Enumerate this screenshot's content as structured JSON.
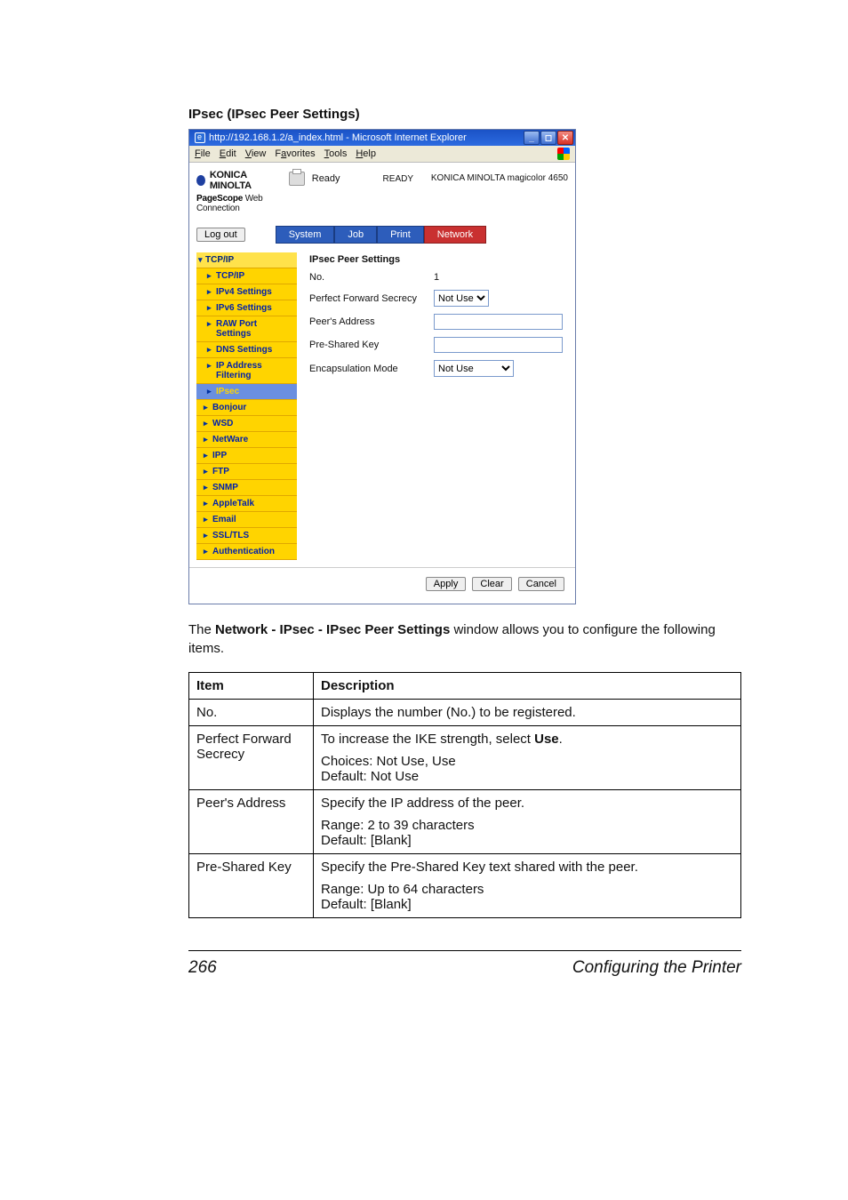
{
  "doc": {
    "heading": "IPsec (IPsec Peer Settings)",
    "copy_prefix": "The ",
    "copy_bold": "Network - IPsec - IPsec Peer Settings",
    "copy_suffix": " window allows you to configure the following items.",
    "page_number": "266",
    "footer_title": "Configuring the Printer"
  },
  "browser": {
    "title": "http://192.168.1.2/a_index.html - Microsoft Internet Explorer",
    "menus": {
      "file": "File",
      "edit": "Edit",
      "view": "View",
      "favorites": "Favorites",
      "tools": "Tools",
      "help": "Help"
    }
  },
  "header": {
    "brand": "KONICA MINOLTA",
    "pagescope_prefix": "PageScope",
    "pagescope_name": " Web Connection",
    "status_label": "Ready",
    "ready_badge": "READY",
    "device": "KONICA MINOLTA magicolor 4650"
  },
  "actions": {
    "logout": "Log out"
  },
  "tabs": {
    "system": "System",
    "job": "Job",
    "print": "Print",
    "network": "Network"
  },
  "nav": {
    "tcpip_group": "TCP/IP",
    "tcpip": "TCP/IP",
    "ipv4": "IPv4 Settings",
    "ipv6": "IPv6 Settings",
    "raw": "RAW Port Settings",
    "dns": "DNS Settings",
    "ipfilter": "IP Address Filtering",
    "ipsec": "IPsec",
    "bonjour": "Bonjour",
    "wsd": "WSD",
    "netware": "NetWare",
    "ipp": "IPP",
    "ftp": "FTP",
    "snmp": "SNMP",
    "appletalk": "AppleTalk",
    "email": "Email",
    "ssltls": "SSL/TLS",
    "auth": "Authentication"
  },
  "form": {
    "panel_title": "IPsec Peer Settings",
    "no_label": "No.",
    "no_value": "1",
    "pfs_label": "Perfect Forward Secrecy",
    "pfs_value": "Not Use",
    "peer_label": "Peer's Address",
    "peer_value": "",
    "psk_label": "Pre-Shared Key",
    "psk_value": "",
    "encap_label": "Encapsulation Mode",
    "encap_value": "Not Use"
  },
  "buttons": {
    "apply": "Apply",
    "clear": "Clear",
    "cancel": "Cancel"
  },
  "table": {
    "h_item": "Item",
    "h_desc": "Description",
    "rows": [
      {
        "item": "No.",
        "desc": "Displays the number (No.) to be registered.",
        "extra": ""
      },
      {
        "item": "Perfect Forward Secrecy",
        "desc": "To increase the IKE strength, select Use.",
        "extra": "Choices: Not Use, Use\nDefault:  Not Use",
        "bold_word": "Use"
      },
      {
        "item": "Peer's Address",
        "desc": "Specify the IP address of the peer.",
        "extra": "Range:   2 to 39 characters\nDefault:  [Blank]"
      },
      {
        "item": "Pre-Shared Key",
        "desc": "Specify the Pre-Shared Key text shared with the peer.",
        "extra": "Range:   Up to 64 characters\nDefault:  [Blank]"
      }
    ]
  },
  "chart_data": {
    "type": "table",
    "title": "IPsec Peer Settings — configurable items",
    "columns": [
      "Item",
      "Description"
    ],
    "rows": [
      [
        "No.",
        "Displays the number (No.) to be registered."
      ],
      [
        "Perfect Forward Secrecy",
        "To increase the IKE strength, select Use. Choices: Not Use, Use. Default: Not Use"
      ],
      [
        "Peer's Address",
        "Specify the IP address of the peer. Range: 2 to 39 characters. Default: [Blank]"
      ],
      [
        "Pre-Shared Key",
        "Specify the Pre-Shared Key text shared with the peer. Range: Up to 64 characters. Default: [Blank]"
      ]
    ]
  }
}
